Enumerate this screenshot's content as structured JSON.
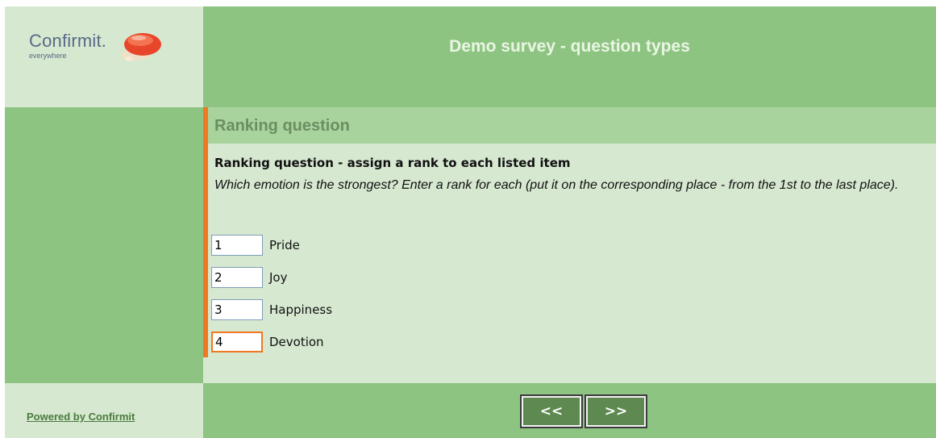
{
  "header": {
    "logo_text": "Confirmit.",
    "logo_tagline": "everywhere",
    "survey_title": "Demo survey - question types"
  },
  "section": {
    "title": "Ranking question"
  },
  "question": {
    "title": "Ranking question - assign a rank to each listed item",
    "text": "Which emotion is the strongest? Enter a rank for each (put it on the corresponding place - from the 1st to the last place).",
    "items": [
      {
        "rank": "1",
        "label": "Pride"
      },
      {
        "rank": "2",
        "label": "Joy"
      },
      {
        "rank": "3",
        "label": "Happiness"
      },
      {
        "rank": "4",
        "label": "Devotion"
      }
    ]
  },
  "footer": {
    "powered_by": "Powered by Confirmit",
    "back_label": "<<",
    "next_label": ">>"
  },
  "colors": {
    "green_dark": "#8ec482",
    "green_light": "#d6e8d0",
    "green_mid": "#a9d39c",
    "accent_orange": "#f07820",
    "button_green": "#5e8a52"
  },
  "icons": {
    "logo": "speech-bubble-logo-icon"
  }
}
